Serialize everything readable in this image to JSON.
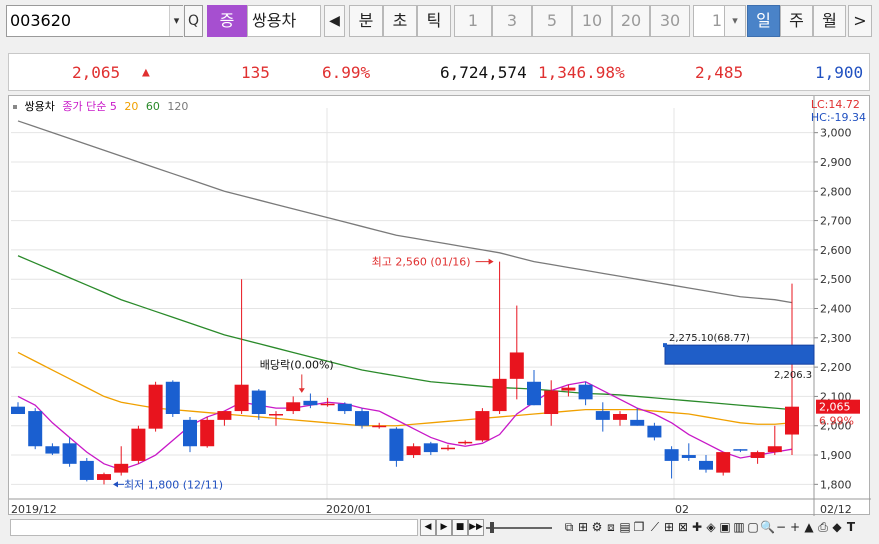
{
  "toolbar": {
    "code": "003620",
    "badge": "증",
    "name": "쌍용차",
    "prev_arrow": "◀",
    "next_arrow": ">",
    "dropdown_arrow": "▾",
    "search_icon": "Q",
    "periods": [
      "분",
      "초",
      "틱"
    ],
    "intervals": [
      "1",
      "3",
      "5",
      "10",
      "20",
      "30"
    ],
    "interval_value": "1",
    "ranges": [
      "일",
      "주",
      "월"
    ],
    "active_range": "일"
  },
  "quote": {
    "price": "2,065",
    "direction": "▲",
    "change": "135",
    "change_rate": "6.99%",
    "volume": "6,724,574",
    "volume_rate": "1,346.98%",
    "high": "2,485",
    "low": "1,900",
    "colors": {
      "up": "#e03030",
      "down": "#2050c0"
    }
  },
  "legend": {
    "name": "쌍용차",
    "ma_label": "종가 단순 5",
    "ma20": "20",
    "ma60": "60",
    "ma120": "120",
    "colors": {
      "ma5": "#c818c8",
      "ma20": "#f0a000",
      "ma60": "#2a8a2a",
      "ma120": "#7a7a7a"
    }
  },
  "lc": "LC:14.72",
  "hc": "HC:-19.34",
  "annotations": {
    "high_label": "최고 2,560 (01/16)",
    "low_label": "최저 1,800 (12/11)",
    "dividend_label": "배당락(0.00%)",
    "box_label": "2,275.10(68.77)",
    "box_right_label": "2,206.3",
    "current_price_label": "2,065",
    "current_rate_label": "6.99%"
  },
  "x_labels": [
    "2019/12",
    "2020/01",
    "02",
    "02/12"
  ],
  "chart_data": {
    "type": "candlestick",
    "title": "쌍용차",
    "ylim": [
      1750,
      3050
    ],
    "y_ticks": [
      1800,
      1900,
      2000,
      2100,
      2200,
      2300,
      2400,
      2500,
      2600,
      2700,
      2800,
      2900,
      3000
    ],
    "y_tick_labels": [
      "1,800",
      "1,900",
      "2,000",
      "2,100",
      "2,200",
      "2,300",
      "2,400",
      "2,500",
      "2,600",
      "2,700",
      "2,800",
      "2,900",
      "3,000"
    ],
    "candles": [
      {
        "o": 2065,
        "h": 2080,
        "l": 2040,
        "c": 2040
      },
      {
        "o": 2050,
        "h": 2060,
        "l": 1920,
        "c": 1930
      },
      {
        "o": 1930,
        "h": 1940,
        "l": 1900,
        "c": 1905
      },
      {
        "o": 1940,
        "h": 1960,
        "l": 1860,
        "c": 1870
      },
      {
        "o": 1880,
        "h": 1890,
        "l": 1810,
        "c": 1815
      },
      {
        "o": 1815,
        "h": 1840,
        "l": 1800,
        "c": 1835
      },
      {
        "o": 1840,
        "h": 1930,
        "l": 1830,
        "c": 1870
      },
      {
        "o": 1880,
        "h": 2000,
        "l": 1870,
        "c": 1990
      },
      {
        "o": 1990,
        "h": 2150,
        "l": 1980,
        "c": 2140
      },
      {
        "o": 2150,
        "h": 2155,
        "l": 2030,
        "c": 2040
      },
      {
        "o": 2020,
        "h": 2030,
        "l": 1910,
        "c": 1930
      },
      {
        "o": 1930,
        "h": 2030,
        "l": 1925,
        "c": 2020
      },
      {
        "o": 2020,
        "h": 2040,
        "l": 2000,
        "c": 2050
      },
      {
        "o": 2050,
        "h": 2500,
        "l": 2040,
        "c": 2140
      },
      {
        "o": 2120,
        "h": 2125,
        "l": 2020,
        "c": 2040
      },
      {
        "o": 2040,
        "h": 2050,
        "l": 2000,
        "c": 2040
      },
      {
        "o": 2050,
        "h": 2100,
        "l": 2040,
        "c": 2080
      },
      {
        "o": 2085,
        "h": 2110,
        "l": 2060,
        "c": 2070
      },
      {
        "o": 2075,
        "h": 2095,
        "l": 2065,
        "c": 2075
      },
      {
        "o": 2075,
        "h": 2080,
        "l": 2040,
        "c": 2050
      },
      {
        "o": 2050,
        "h": 2060,
        "l": 1990,
        "c": 2000
      },
      {
        "o": 2000,
        "h": 2010,
        "l": 1990,
        "c": 2000
      },
      {
        "o": 1990,
        "h": 1995,
        "l": 1860,
        "c": 1880
      },
      {
        "o": 1900,
        "h": 1940,
        "l": 1890,
        "c": 1930
      },
      {
        "o": 1940,
        "h": 1945,
        "l": 1900,
        "c": 1910
      },
      {
        "o": 1925,
        "h": 1935,
        "l": 1915,
        "c": 1925
      },
      {
        "o": 1940,
        "h": 1950,
        "l": 1935,
        "c": 1945
      },
      {
        "o": 1950,
        "h": 2060,
        "l": 1945,
        "c": 2050
      },
      {
        "o": 2050,
        "h": 2560,
        "l": 2040,
        "c": 2160
      },
      {
        "o": 2160,
        "h": 2410,
        "l": 2090,
        "c": 2250
      },
      {
        "o": 2150,
        "h": 2190,
        "l": 2070,
        "c": 2070
      },
      {
        "o": 2040,
        "h": 2155,
        "l": 2000,
        "c": 2120
      },
      {
        "o": 2120,
        "h": 2140,
        "l": 2100,
        "c": 2130
      },
      {
        "o": 2140,
        "h": 2150,
        "l": 2070,
        "c": 2090
      },
      {
        "o": 2050,
        "h": 2080,
        "l": 1980,
        "c": 2020
      },
      {
        "o": 2020,
        "h": 2050,
        "l": 2000,
        "c": 2040
      },
      {
        "o": 2020,
        "h": 2060,
        "l": 2000,
        "c": 2000
      },
      {
        "o": 2000,
        "h": 2010,
        "l": 1950,
        "c": 1960
      },
      {
        "o": 1920,
        "h": 1930,
        "l": 1820,
        "c": 1880
      },
      {
        "o": 1900,
        "h": 1940,
        "l": 1880,
        "c": 1890
      },
      {
        "o": 1880,
        "h": 1900,
        "l": 1840,
        "c": 1850
      },
      {
        "o": 1840,
        "h": 1910,
        "l": 1830,
        "c": 1910
      },
      {
        "o": 1920,
        "h": 1920,
        "l": 1910,
        "c": 1915
      },
      {
        "o": 1890,
        "h": 1915,
        "l": 1870,
        "c": 1910
      },
      {
        "o": 1910,
        "h": 2000,
        "l": 1900,
        "c": 1930
      },
      {
        "o": 1970,
        "h": 2485,
        "l": 1900,
        "c": 2065
      }
    ],
    "ma5": [
      2100,
      2070,
      2010,
      1960,
      1910,
      1870,
      1850,
      1870,
      1900,
      1950,
      2000,
      2030,
      2050,
      2080,
      2070,
      2060,
      2060,
      2070,
      2080,
      2075,
      2060,
      2050,
      2020,
      1990,
      1960,
      1940,
      1930,
      1940,
      1970,
      2040,
      2080,
      2120,
      2140,
      2150,
      2120,
      2090,
      2060,
      2040,
      2010,
      1970,
      1940,
      1910,
      1890,
      1900,
      1910,
      1920
    ],
    "ma20": [
      2250,
      2220,
      2190,
      2160,
      2130,
      2100,
      2080,
      2070,
      2060,
      2055,
      2050,
      2045,
      2040,
      2035,
      2030,
      2025,
      2020,
      2015,
      2010,
      2005,
      2000,
      2000,
      2000,
      2005,
      2010,
      2015,
      2020,
      2025,
      2030,
      2035,
      2040,
      2045,
      2050,
      2055,
      2055,
      2055,
      2055,
      2050,
      2045,
      2040,
      2030,
      2020,
      2010,
      2005,
      2005,
      2010
    ],
    "ma60": [
      2580,
      2555,
      2530,
      2505,
      2480,
      2455,
      2430,
      2410,
      2390,
      2370,
      2350,
      2330,
      2310,
      2295,
      2280,
      2265,
      2250,
      2235,
      2220,
      2205,
      2190,
      2180,
      2170,
      2160,
      2150,
      2145,
      2140,
      2135,
      2130,
      2128,
      2125,
      2120,
      2115,
      2110,
      2108,
      2105,
      2100,
      2095,
      2090,
      2085,
      2080,
      2075,
      2070,
      2065,
      2060,
      2055
    ],
    "ma120": [
      3040,
      3020,
      3000,
      2980,
      2960,
      2940,
      2920,
      2900,
      2880,
      2860,
      2840,
      2820,
      2800,
      2785,
      2770,
      2755,
      2740,
      2725,
      2710,
      2695,
      2680,
      2665,
      2650,
      2640,
      2630,
      2620,
      2610,
      2600,
      2590,
      2575,
      2560,
      2550,
      2540,
      2530,
      2520,
      2510,
      2500,
      2490,
      2480,
      2470,
      2460,
      2450,
      2440,
      2435,
      2430,
      2420
    ]
  }
}
